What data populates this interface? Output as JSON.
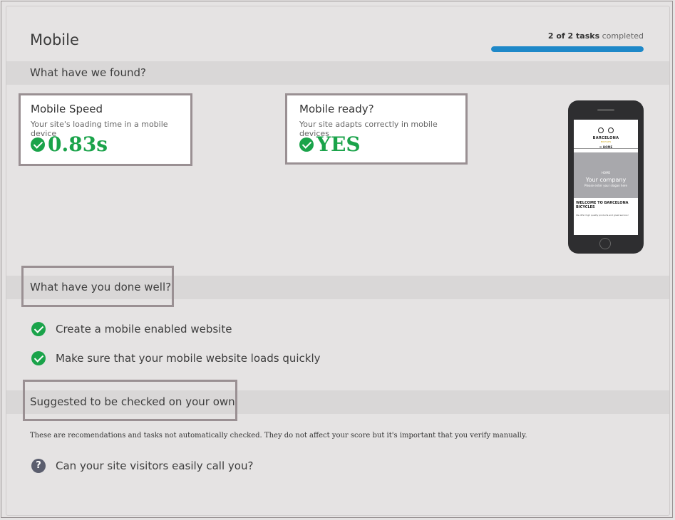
{
  "page": {
    "title": "Mobile"
  },
  "progress": {
    "count": "2 of 2 tasks",
    "suffix": "completed",
    "fraction": 1.0
  },
  "sections": {
    "found": "What have we found?",
    "done_well": "What have you done well?",
    "suggested": "Suggested to be checked on your own"
  },
  "cards": {
    "speed": {
      "title": "Mobile Speed",
      "subtitle": "Your site's loading time in a mobile device",
      "value": "0.83s"
    },
    "ready": {
      "title": "Mobile ready?",
      "subtitle": "Your site adapts correctly in mobile devices",
      "value": "YES"
    }
  },
  "phone_preview": {
    "brand": "BARCELONA",
    "brand_sub": "BICYCLES",
    "menu": "☰ HOME",
    "hero_small": "HOME",
    "hero_title": "Your company",
    "hero_sub": "Please enter your slogan here",
    "body_title": "WELCOME TO BARCELONA BICYCLES",
    "body_text": "We offer high quality products and great service!"
  },
  "done_items": [
    "Create a mobile enabled website",
    "Make sure that your mobile website loads quickly"
  ],
  "suggested_note": "These are recomendations and tasks not automatically checked. They do not affect your score but it's important that you verify manually.",
  "suggested_items": [
    "Can your site visitors easily call you?"
  ],
  "colors": {
    "accent": "#1e88c8",
    "success": "#1aa34a",
    "highlight_border": "#9a9093"
  },
  "icons": {
    "check": "check-circle-icon",
    "question": "question-circle-icon"
  }
}
